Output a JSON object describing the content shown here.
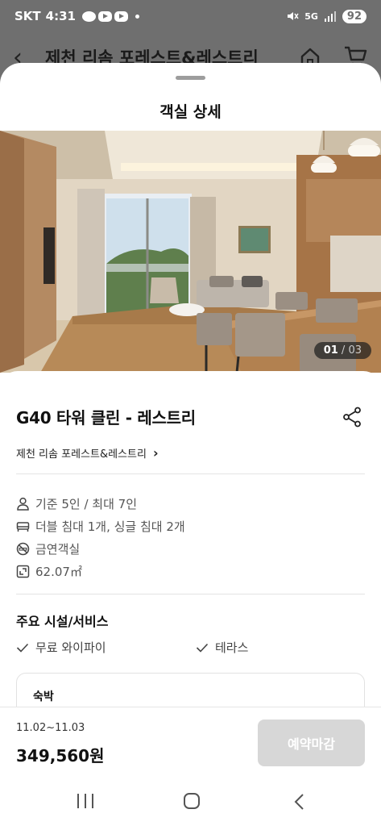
{
  "status_bar": {
    "carrier": "SKT",
    "time": "4:31",
    "network": "5G",
    "battery": "92"
  },
  "background_header": {
    "title": "제천 리솜 포레스트&레스트리"
  },
  "sheet": {
    "title": "객실 상세",
    "photo_counter": {
      "current": "01",
      "separator": " / ",
      "total": "03"
    }
  },
  "room": {
    "name": "G40 타워 클린 - 레스트리",
    "hotel_link": "제천 리솜 포레스트&레스트리",
    "specs": [
      {
        "icon": "person-icon",
        "text": "기준 5인 / 최대 7인"
      },
      {
        "icon": "bed-icon",
        "text": "더블 침대 1개, 싱글 침대 2개"
      },
      {
        "icon": "no-smoking-icon",
        "text": "금연객실"
      },
      {
        "icon": "area-icon",
        "text": "62.07㎡"
      }
    ]
  },
  "facilities": {
    "title": "주요 시설/서비스",
    "items": [
      "무료 와이파이",
      "테라스"
    ]
  },
  "stay_card": {
    "label": "숙박"
  },
  "booking": {
    "dates": "11.02~11.03",
    "price": "349,560원",
    "button_label": "예약마감"
  },
  "colors": {
    "button_disabled": "#d7d7d7",
    "dim_overlay": "#6f6f6f",
    "counter_bg": "#2a2a2a"
  }
}
